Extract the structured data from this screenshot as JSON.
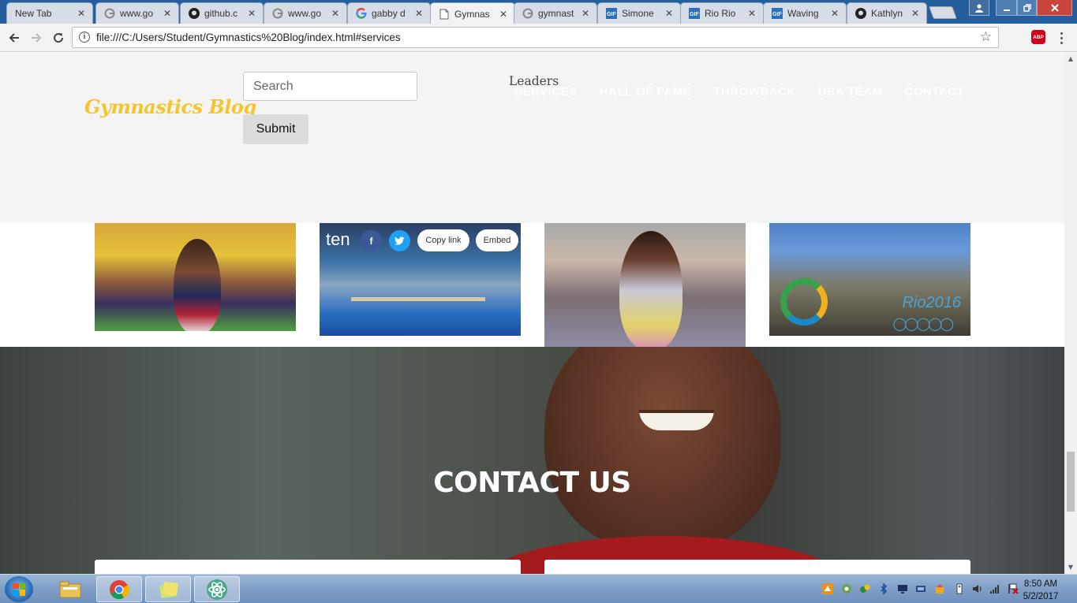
{
  "browser": {
    "tabs": [
      {
        "label": "New Tab",
        "icon": "none",
        "active": false
      },
      {
        "label": "www.go",
        "icon": "google-icon",
        "active": false
      },
      {
        "label": "github.c",
        "icon": "github-icon",
        "active": false
      },
      {
        "label": "www.go",
        "icon": "google-icon",
        "active": false
      },
      {
        "label": "gabby d",
        "icon": "google-g-icon",
        "active": false
      },
      {
        "label": "Gymnas",
        "icon": "page-icon",
        "active": true
      },
      {
        "label": "gymnast",
        "icon": "google-icon",
        "active": false
      },
      {
        "label": "Simone",
        "icon": "gif-icon",
        "active": false
      },
      {
        "label": "Rio Rio",
        "icon": "gif-icon",
        "active": false
      },
      {
        "label": "Waving",
        "icon": "gif-icon",
        "active": false
      },
      {
        "label": "Kathlyn",
        "icon": "github-icon",
        "active": false
      }
    ],
    "tab_close_glyph": "✕",
    "url": "file:///C:/Users/Student/Gymnastics%20Blog/index.html#services",
    "info_glyph": "i",
    "abp_label": "ABP"
  },
  "site": {
    "logo": "Gymnastics Blog",
    "search_placeholder": "Search",
    "submit_label": "Submit",
    "leaders": "Leaders",
    "nav": [
      "SERVICES",
      "HALL OF FAME",
      "THROWBACK",
      "USA TEAM",
      "CONTACT"
    ]
  },
  "embed": {
    "brand": "ten",
    "facebook": "f",
    "copy_link": "Copy link",
    "embed_label": "Embed"
  },
  "rio": {
    "text": "Rio2016"
  },
  "contact": {
    "title": "CONTACT US"
  },
  "taskbar": {
    "time": "8:50 AM",
    "date": "5/2/2017"
  },
  "colors": {
    "logo": "#f6c42c",
    "tabstrip": "#245e9c",
    "facebook": "#3b5998",
    "twitter": "#1da1f2",
    "abp": "#d0021b"
  }
}
